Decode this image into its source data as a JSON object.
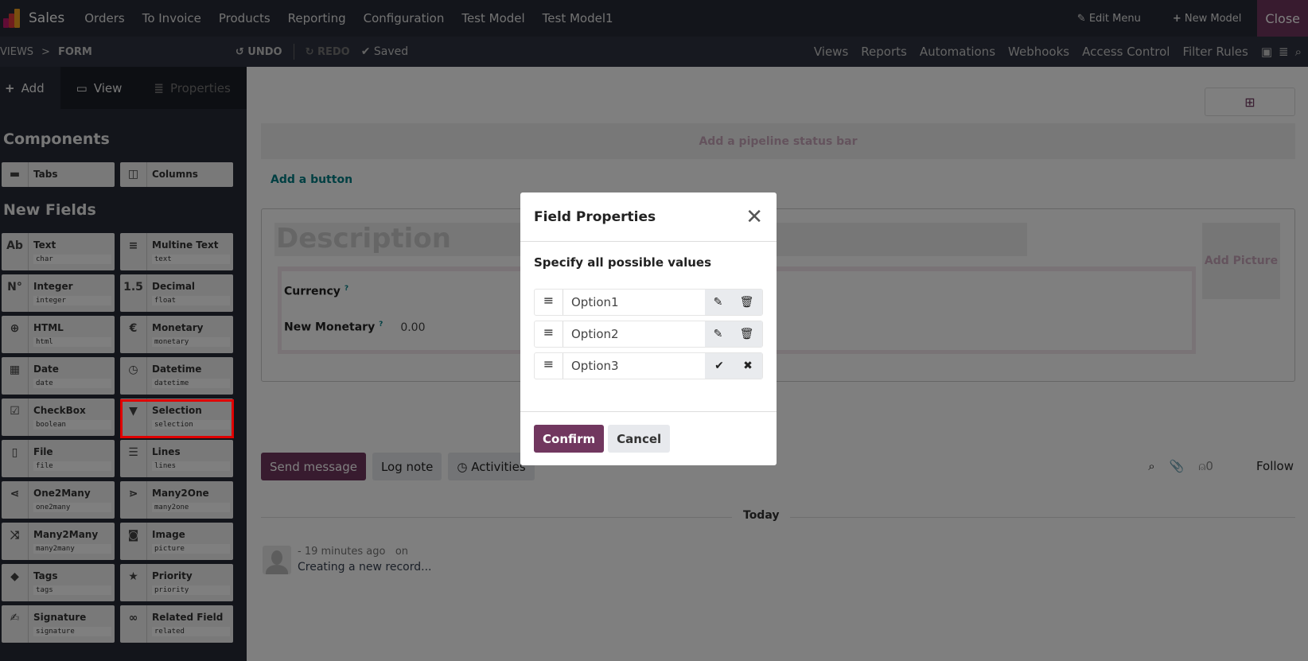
{
  "app": {
    "name": "Sales",
    "menu": [
      "Orders",
      "To Invoice",
      "Products",
      "Reporting",
      "Configuration",
      "Test Model",
      "Test Model1"
    ],
    "edit_menu": "Edit Menu",
    "new_model": "New Model",
    "close": "Close"
  },
  "toolbar": {
    "breadcrumb": [
      "VIEWS",
      "FORM"
    ],
    "undo": "UNDO",
    "redo": "REDO",
    "saved": "Saved",
    "links": [
      "Views",
      "Reports",
      "Automations",
      "Webhooks",
      "Access Control",
      "Filter Rules"
    ]
  },
  "sidebar": {
    "tabs": [
      "Add",
      "View",
      "Properties"
    ],
    "components_title": "Components",
    "components": [
      {
        "icon": "tabs-icon",
        "glyph": "▬",
        "label": "Tabs"
      },
      {
        "icon": "columns-icon",
        "glyph": "◫",
        "label": "Columns"
      }
    ],
    "new_fields_title": "New Fields",
    "fields": [
      {
        "icon": "text-icon",
        "glyph": "Ab",
        "label": "Text",
        "type": "char"
      },
      {
        "icon": "multiline-icon",
        "glyph": "≡",
        "label": "Multine Text",
        "type": "text"
      },
      {
        "icon": "integer-icon",
        "glyph": "N°",
        "label": "Integer",
        "type": "integer"
      },
      {
        "icon": "decimal-icon",
        "glyph": "1.5",
        "label": "Decimal",
        "type": "float"
      },
      {
        "icon": "globe-icon",
        "glyph": "⊕",
        "label": "HTML",
        "type": "html"
      },
      {
        "icon": "euro-icon",
        "glyph": "€",
        "label": "Monetary",
        "type": "monetary"
      },
      {
        "icon": "calendar-icon",
        "glyph": "▦",
        "label": "Date",
        "type": "date"
      },
      {
        "icon": "calendar-clock-icon",
        "glyph": "◷",
        "label": "Datetime",
        "type": "datetime"
      },
      {
        "icon": "checkbox-icon",
        "glyph": "☑",
        "label": "CheckBox",
        "type": "boolean"
      },
      {
        "icon": "caret-down-icon",
        "glyph": "▼",
        "label": "Selection",
        "type": "selection"
      },
      {
        "icon": "file-icon",
        "glyph": "▯",
        "label": "File",
        "type": "file"
      },
      {
        "icon": "list-icon",
        "glyph": "☰",
        "label": "Lines",
        "type": "lines"
      },
      {
        "icon": "share-icon",
        "glyph": "⋖",
        "label": "One2Many",
        "type": "one2many"
      },
      {
        "icon": "branch-icon",
        "glyph": "⋗",
        "label": "Many2One",
        "type": "many2one"
      },
      {
        "icon": "shuffle-icon",
        "glyph": "⤨",
        "label": "Many2Many",
        "type": "many2many"
      },
      {
        "icon": "camera-icon",
        "glyph": "◙",
        "label": "Image",
        "type": "picture"
      },
      {
        "icon": "tag-icon",
        "glyph": "◆",
        "label": "Tags",
        "type": "tags"
      },
      {
        "icon": "star-icon",
        "glyph": "★",
        "label": "Priority",
        "type": "priority"
      },
      {
        "icon": "signature-icon",
        "glyph": "✍",
        "label": "Signature",
        "type": "signature"
      },
      {
        "icon": "link-icon",
        "glyph": "∞",
        "label": "Related Field",
        "type": "related"
      }
    ]
  },
  "form": {
    "pipeline": "Add a pipeline status bar",
    "add_button": "Add a button",
    "title_placeholder": "Description",
    "add_picture": "Add Picture",
    "fields": [
      {
        "label": "Currency",
        "value": ""
      },
      {
        "label": "New Monetary",
        "value": "0.00"
      }
    ],
    "help": "?"
  },
  "chatter": {
    "send_message": "Send message",
    "log_note": "Log note",
    "activities": "Activities",
    "followers": "0",
    "follow": "Follow",
    "today": "Today",
    "message_time": "- 19 minutes ago",
    "message_on": "on",
    "message_body": "Creating a new record..."
  },
  "modal": {
    "title": "Field Properties",
    "subtitle": "Specify all possible values",
    "options": [
      {
        "value": "Option1",
        "editing": false
      },
      {
        "value": "Option2",
        "editing": false
      },
      {
        "value": "Option3",
        "editing": true
      }
    ],
    "confirm": "Confirm",
    "cancel": "Cancel"
  },
  "colors": {
    "brand": "#71375f",
    "highlight": "#e00000",
    "link": "#017e84"
  }
}
